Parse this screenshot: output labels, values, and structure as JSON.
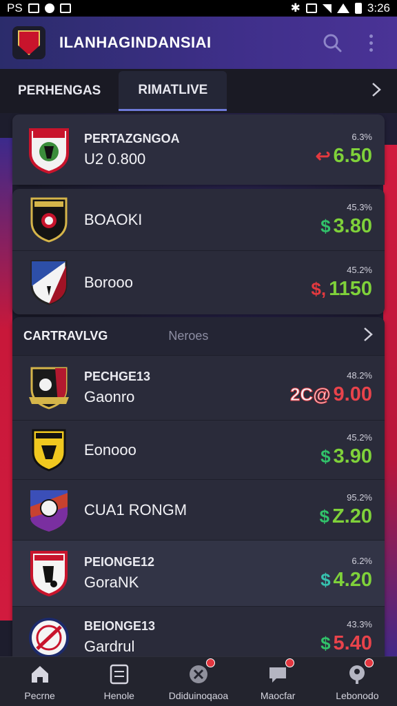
{
  "status_bar": {
    "left_text": "PS",
    "time": "3:26"
  },
  "app": {
    "title": "ILANHAGINDANSIAI"
  },
  "tabs": [
    {
      "label": "PERHENGAS"
    },
    {
      "label": "RIMATLIVE"
    }
  ],
  "card1": {
    "rows": [
      {
        "sub": "PERTAZGNGOA",
        "name": "U2 0.800",
        "pct": "6.3%",
        "sym": "↩",
        "odd": "6.50",
        "sym_color": "red",
        "odd_color": "green"
      },
      {
        "sub": "",
        "name": "BOAOKI",
        "pct": "45.3%",
        "sym": "$",
        "odd": "3.80",
        "sym_color": "green",
        "odd_color": "green"
      },
      {
        "sub": "",
        "name": "Borooo",
        "pct": "45.2%",
        "sym": "$,",
        "odd": "1150",
        "sym_color": "red",
        "odd_color": "green"
      }
    ]
  },
  "section": {
    "title": "CARTRAVLVG",
    "link": "Neroes"
  },
  "card2": {
    "rows": [
      {
        "sub": "PECHGE13",
        "name": "Gaonro",
        "pct": "48.2%",
        "sym": "2C@",
        "odd": "9.00",
        "sym_color": "red",
        "odd_color": "red"
      },
      {
        "sub": "",
        "name": "Eonooo",
        "pct": "45.2%",
        "sym": "$",
        "odd": "3.90",
        "sym_color": "green",
        "odd_color": "green"
      },
      {
        "sub": "",
        "name": "CUA1 RONGM",
        "pct": "95.2%",
        "sym": "$",
        "odd": "Z.20",
        "sym_color": "green",
        "odd_color": "green"
      },
      {
        "sub": "PEIONGE12",
        "name": "GoraNK",
        "pct": "6.2%",
        "sym": "$",
        "odd": "4.20",
        "sym_color": "teal",
        "odd_color": "green"
      },
      {
        "sub": "BEIONGE13",
        "name": "Gardrul",
        "pct": "43.3%",
        "sym": "$",
        "odd": "5.40",
        "sym_color": "green",
        "odd_color": "red"
      }
    ]
  },
  "bottom_nav": [
    {
      "label": "Pecrne",
      "icon": "home-icon"
    },
    {
      "label": "Henole",
      "icon": "scoreboard-icon"
    },
    {
      "label": "Ddiduinoqaoa",
      "icon": "cancel-icon"
    },
    {
      "label": "Maocfar",
      "icon": "chat-icon"
    },
    {
      "label": "Lebonodo",
      "icon": "profile-icon"
    }
  ],
  "colors": {
    "accent": "#6e7ad8",
    "green": "#7fd13a",
    "red": "#e8434b",
    "appbar": "#3f2f8a"
  }
}
